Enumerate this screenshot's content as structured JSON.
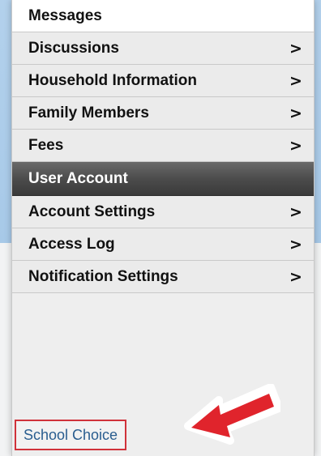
{
  "menu": {
    "items": [
      {
        "label": "Messages",
        "chevron": ""
      },
      {
        "label": "Discussions",
        "chevron": ">"
      },
      {
        "label": "Household Information",
        "chevron": ">"
      },
      {
        "label": "Family Members",
        "chevron": ">"
      },
      {
        "label": "Fees",
        "chevron": ">"
      }
    ],
    "section_header": "User Account",
    "account_items": [
      {
        "label": "Account Settings",
        "chevron": ">"
      },
      {
        "label": "Access Log",
        "chevron": ">"
      },
      {
        "label": "Notification Settings",
        "chevron": ">"
      }
    ],
    "link": "School Choice"
  },
  "colors": {
    "highlight_border": "#d0323a",
    "arrow": "#e0242c",
    "link_text": "#2a5d8f"
  },
  "icons": {
    "chevron": "chevron-right-icon",
    "arrow": "red-arrow-icon"
  }
}
